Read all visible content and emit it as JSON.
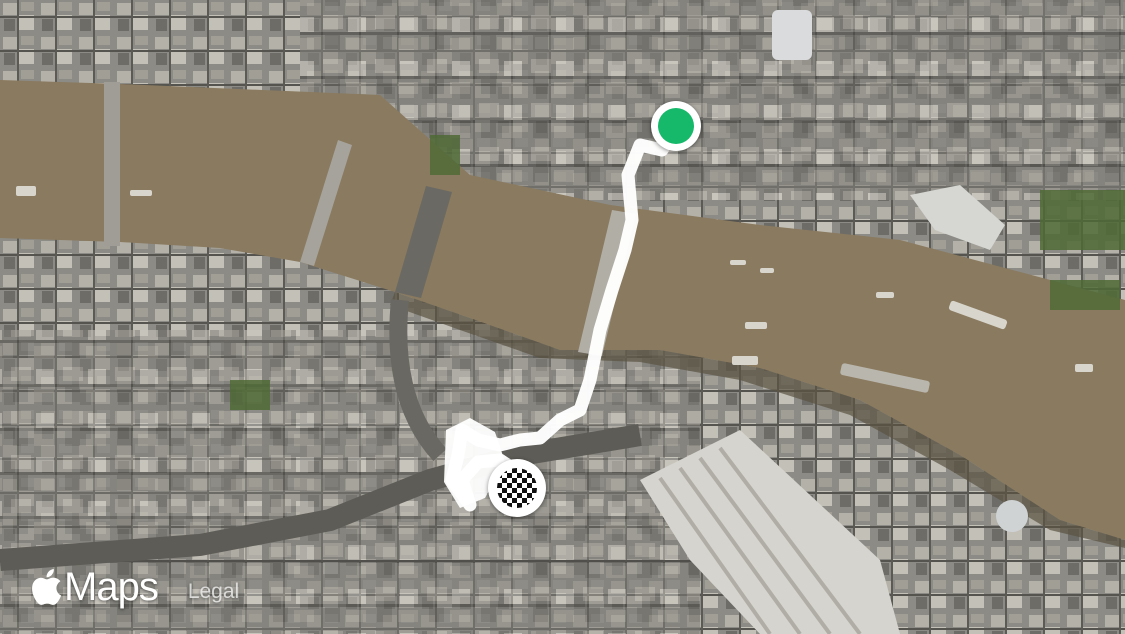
{
  "map": {
    "view": "satellite",
    "river_color": "#8a7a5f",
    "route_color": "#ffffff",
    "start_marker_color": "#16b96a"
  },
  "markers": {
    "start": {
      "icon": "green-dot"
    },
    "finish": {
      "icon": "checkered-flag"
    }
  },
  "attribution": {
    "logo_icon": "apple-logo",
    "brand": "Maps",
    "legal_label": "Legal"
  }
}
